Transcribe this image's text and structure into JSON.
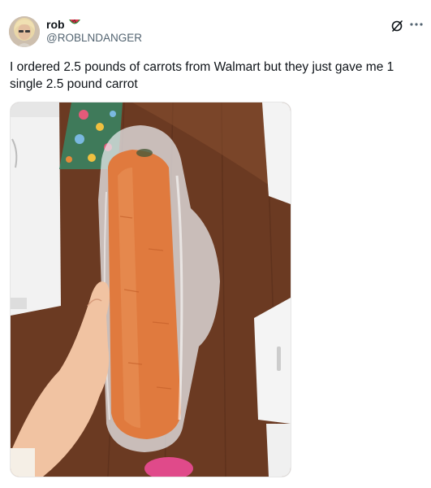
{
  "post": {
    "author": {
      "display_name": "rob",
      "name_emoji": "watermelon-slice-icon",
      "handle": "@ROBLNDANGER"
    },
    "text": "I ordered 2.5 pounds of carrots from Walmart but they just gave me 1 single 2.5 pound carrot",
    "media": {
      "type": "photo",
      "subject": "hand holding a single large carrot in a plastic bag"
    },
    "actions": {
      "grok_icon": "grok-icon",
      "more_icon": "more-options-icon"
    }
  },
  "colors": {
    "text_primary": "#0f1419",
    "text_secondary": "#536471",
    "carrot": "#e07a3e",
    "floor": "#6b3a22"
  }
}
